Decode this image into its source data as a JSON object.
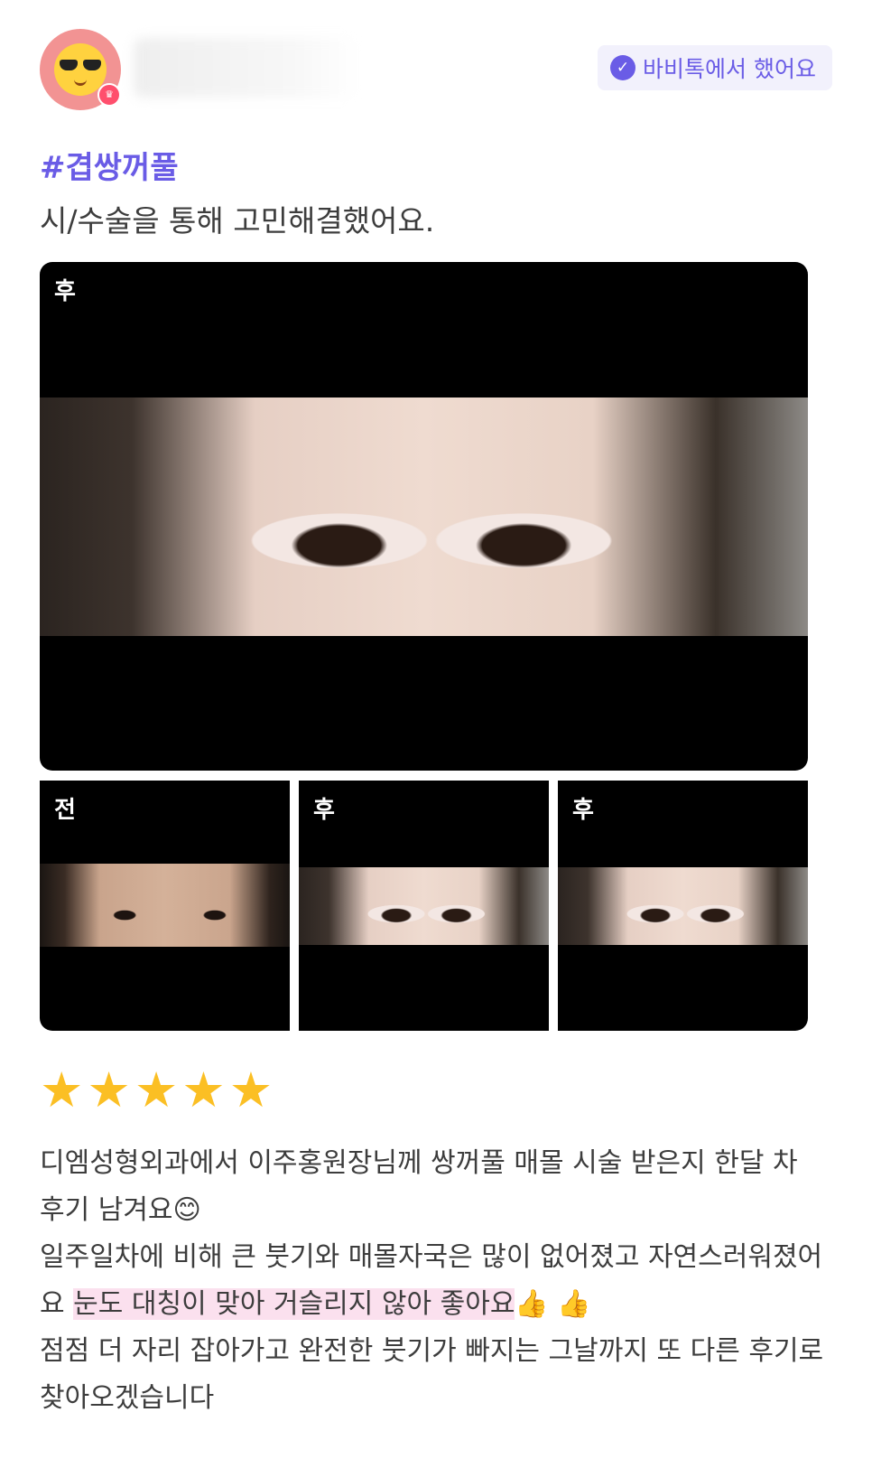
{
  "header": {
    "verified_label": "바비톡에서 했어요",
    "icons": {
      "avatar": "sunglasses-emoji-avatar",
      "verified": "check-badge-icon",
      "crown": "crown-icon"
    }
  },
  "post": {
    "hashtag": "#겹쌍꺼풀",
    "subtitle": "시/수술을 통해 고민해결했어요."
  },
  "photos": {
    "main": {
      "tag": "후"
    },
    "thumbs": [
      {
        "tag": "전"
      },
      {
        "tag": "후"
      },
      {
        "tag": "후"
      }
    ]
  },
  "rating": {
    "stars": 5,
    "max": 5,
    "color": "#fbbf24"
  },
  "review": {
    "line1": "디엠성형외과에서 이주홍원장님께 쌍꺼풀 매몰 시술 받은지 한달 차 후기 남겨요",
    "emoji_smile": "😊",
    "line2_start": "일주일차에 비해 큰 붓기와 매몰자국은 많이 없어졌고 자연스러워졌어요 ",
    "line2_highlight": "눈도 대칭이 맞아 거슬리지 않아 좋아요",
    "emoji_thumbs": "👍 👍",
    "line3": "점점 더 자리 잡아가고 완전한 붓기가 빠지는 그날까지 또 다른 후기로 찾아오겠습니다"
  },
  "colors": {
    "accent": "#6a5ce6",
    "highlight": "#fbe0ee"
  }
}
